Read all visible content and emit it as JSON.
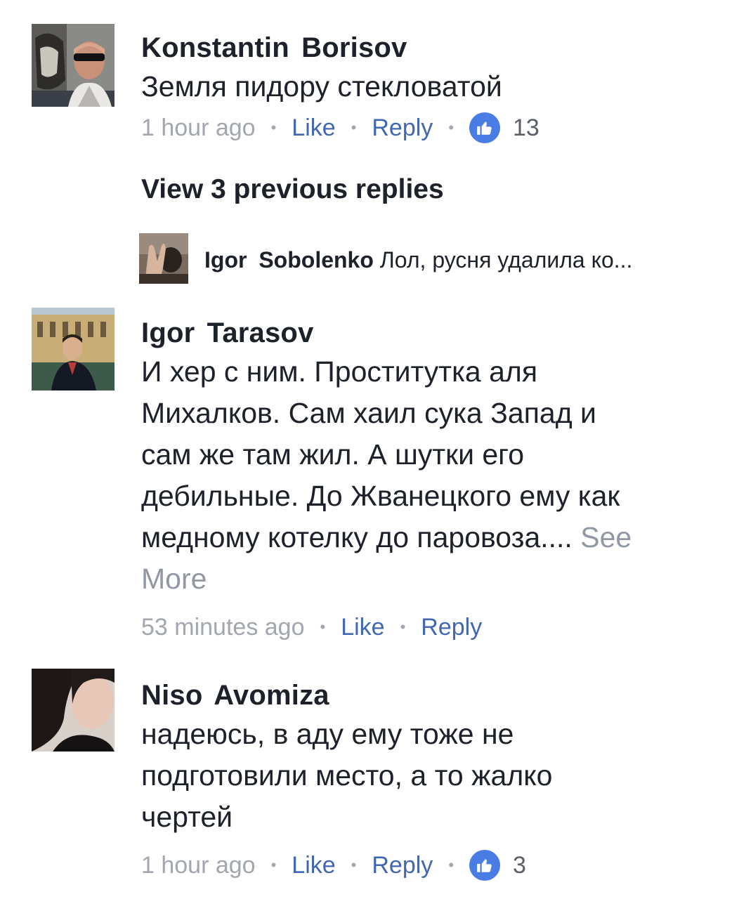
{
  "comments": [
    {
      "author": "Konstantin  Borisov",
      "text": "Земля пидору стекловатой",
      "time": "1 hour ago",
      "like_label": "Like",
      "reply_label": "Reply",
      "like_count": "13"
    },
    {
      "author": "Igor Tarasov",
      "text_lines": [
        "И хер с ним. Проститутка аля",
        "Михалков. Сам хаил сука Запад и",
        "сам же там жил. А шутки его",
        "дебильные. До Жванецкого ему как",
        "медному котелку до паровоза...."
      ],
      "see_more": "See",
      "see_more_2": "More",
      "time": "53 minutes ago",
      "like_label": "Like",
      "reply_label": "Reply"
    },
    {
      "author": "Niso Avomiza",
      "text_lines": [
        "надеюсь, в аду ему тоже не",
        "подготовили место, а то жалко",
        "чертей"
      ],
      "time": "1 hour ago",
      "like_label": "Like",
      "reply_label": "Reply",
      "like_count": "3"
    }
  ],
  "replies": {
    "view_previous": "View 3 previous replies",
    "preview": {
      "author": "Igor  Sobolenko",
      "text": "Лол, русня удалила ко..."
    }
  },
  "colors": {
    "link": "#4267b2",
    "meta": "#9197a3",
    "like_badge": "#4a7ce5"
  },
  "icons": {
    "like": "thumbs-up-icon"
  }
}
